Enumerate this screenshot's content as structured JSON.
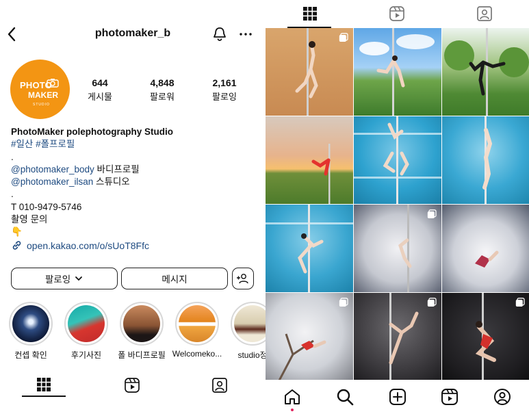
{
  "profile": {
    "username": "photomaker_b",
    "avatar_text": {
      "line1": "PHOTO",
      "line2": "MAKER",
      "line3": "STUDIO"
    },
    "stats": [
      {
        "value": "644",
        "label": "게시물"
      },
      {
        "value": "4,848",
        "label": "팔로워"
      },
      {
        "value": "2,161",
        "label": "팔로잉"
      }
    ],
    "bio": {
      "name": "PhotoMaker polephotography Studio",
      "hashtags": "#일산 #폴프로필",
      "dot1": ".",
      "mention1": "@photomaker_body",
      "mention1_suffix": " 바디프로필",
      "mention2": "@photomaker_ilsan",
      "mention2_suffix": " 스튜디오",
      "dot2": ".",
      "phone": "T 010-9479-5746",
      "inquiry": "촬영 문의",
      "emoji": "👇",
      "link": "open.kakao.com/o/sUoT8Ffc"
    }
  },
  "buttons": {
    "following": "팔로잉",
    "message": "메시지"
  },
  "highlights": [
    {
      "label": "컨셉 확인"
    },
    {
      "label": "후기사진"
    },
    {
      "label": "폴 바디프로필"
    },
    {
      "label": "Welcomeko..."
    },
    {
      "label": "studio정"
    }
  ],
  "colors": {
    "brand": "#f39513",
    "link": "#1d4a80",
    "notification_dot": "#e0245e"
  },
  "icons": {
    "tabs": [
      "grid-icon",
      "reels-icon",
      "tagged-icon"
    ],
    "bottom_nav": [
      "home-icon",
      "search-icon",
      "create-icon",
      "reels-icon",
      "profile-icon"
    ]
  }
}
